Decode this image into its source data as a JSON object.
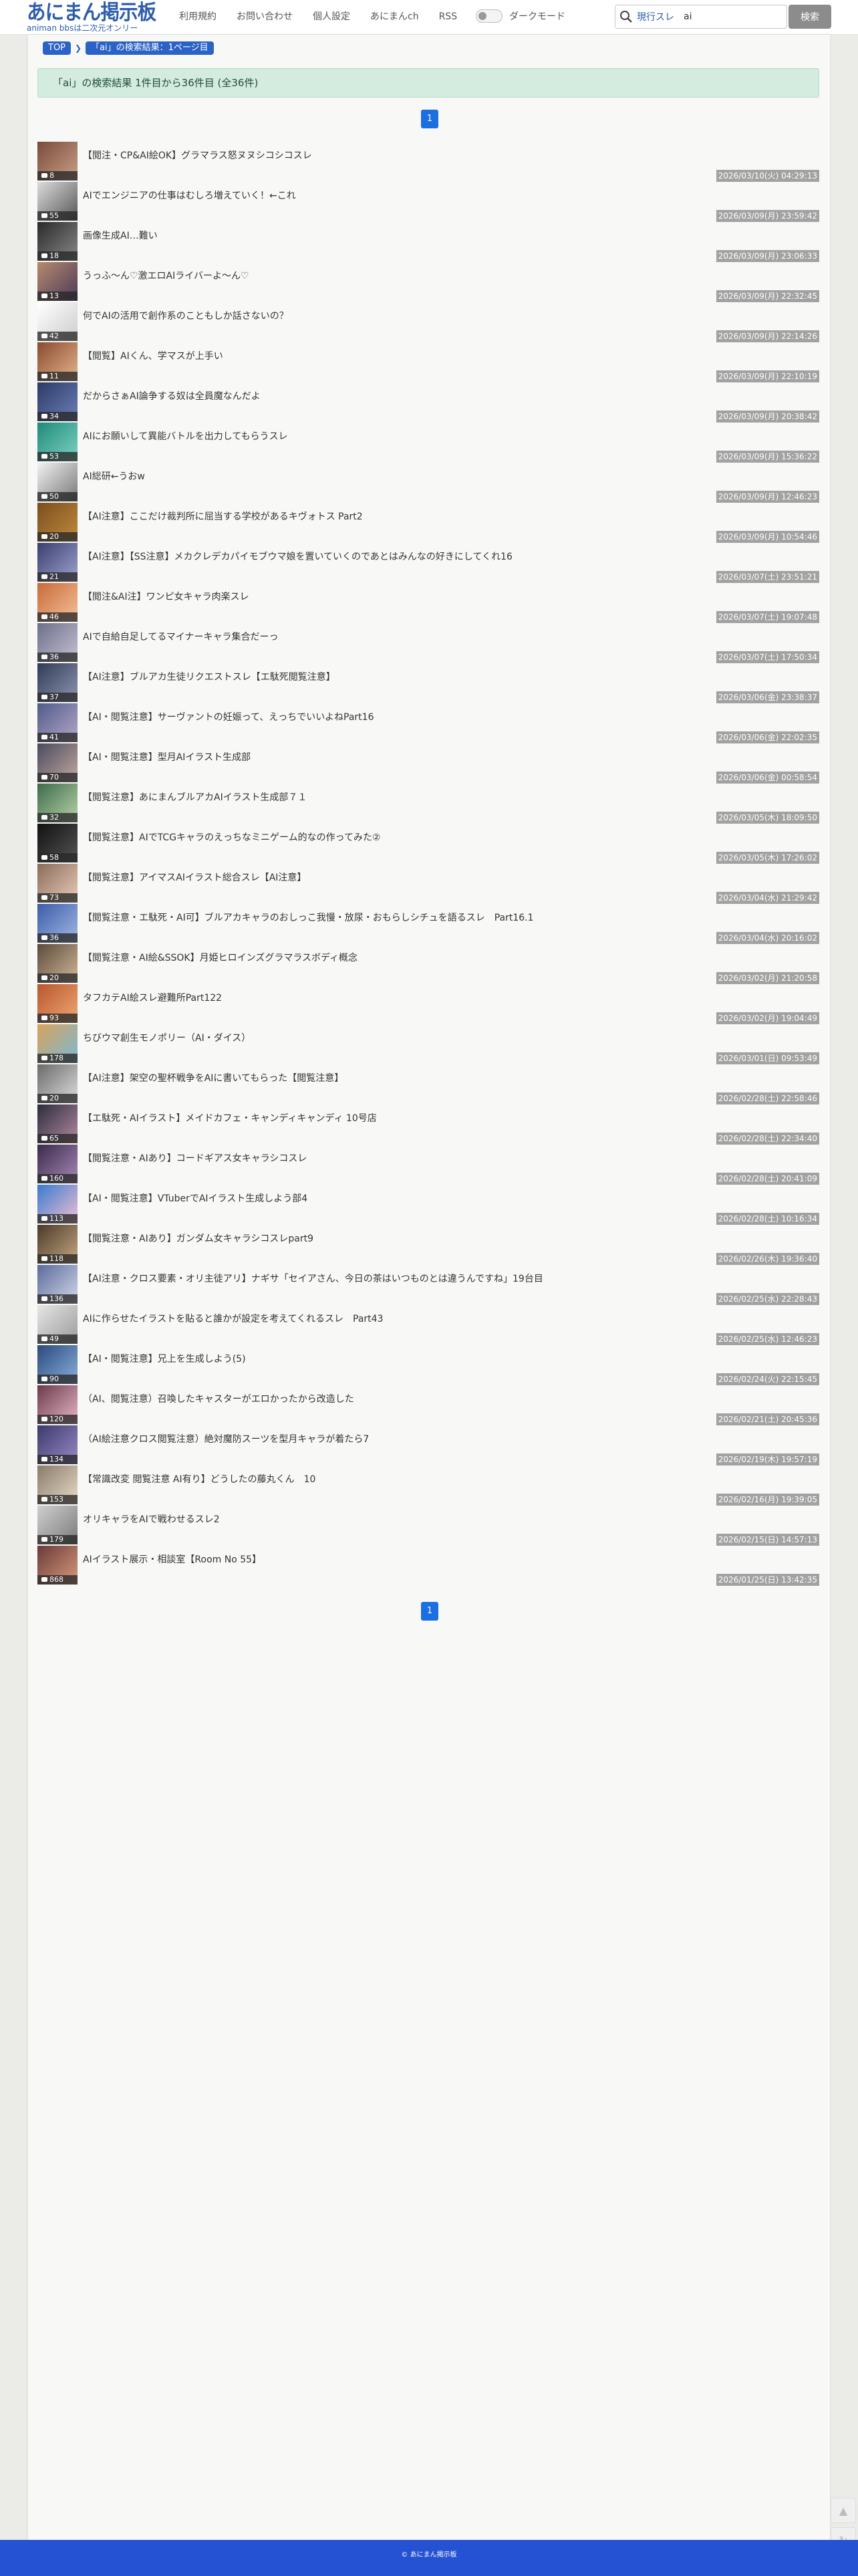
{
  "header": {
    "logo_main": "あにまん掲示板",
    "logo_sub": "animan bbsは二次元オンリー",
    "nav": [
      "利用規約",
      "お問い合わせ",
      "個人設定",
      "あにまんch",
      "RSS"
    ],
    "dark_mode_label": "ダークモード",
    "search_scope": "現行スレ",
    "search_value": "ai",
    "search_button": "検索"
  },
  "breadcrumb": [
    "TOP",
    "「ai」の検索結果：1ページ目"
  ],
  "result_banner": "「ai」の検索結果 1件目から36件目 (全36件)",
  "pagination": {
    "current": "1"
  },
  "threads": [
    {
      "title": "【閲注・CP&AI絵OK】グラマラス怒ヌヌシコシコスレ",
      "count": "8",
      "date": "2026/03/10(火) 04:29:13",
      "c1": "#7a4a3a",
      "c2": "#c9a187"
    },
    {
      "title": "AIでエンジニアの仕事はむしろ増えていく！←これ",
      "count": "55",
      "date": "2026/03/09(月) 23:59:42",
      "c1": "#dcdcdc",
      "c2": "#555555"
    },
    {
      "title": "画像生成AI…難い",
      "count": "18",
      "date": "2026/03/09(月) 23:06:33",
      "c1": "#2a2a2a",
      "c2": "#888888"
    },
    {
      "title": "うっふ〜ん♡激エロAIライバーよ〜ん♡",
      "count": "13",
      "date": "2026/03/09(月) 22:32:45",
      "c1": "#b88a6c",
      "c2": "#4a3a5a"
    },
    {
      "title": "何でAIの活用で創作系のこともしか話さないの？",
      "count": "42",
      "date": "2026/03/09(月) 22:14:26",
      "c1": "#ffffff",
      "c2": "#cccccc"
    },
    {
      "title": "【閲覧】AIくん、学マスが上手い",
      "count": "11",
      "date": "2026/03/09(月) 22:10:19",
      "c1": "#8b4a2f",
      "c2": "#e4b58d"
    },
    {
      "title": "だからさぁAI論争する奴は全員魔なんだよ",
      "count": "34",
      "date": "2026/03/09(月) 20:38:42",
      "c1": "#2c3a66",
      "c2": "#6b7fb8"
    },
    {
      "title": "AIにお願いして異能バトルを出力してもらうスレ",
      "count": "53",
      "date": "2026/03/09(月) 15:36:22",
      "c1": "#1f8a7a",
      "c2": "#7fd3c2"
    },
    {
      "title": "AI総研←うおw",
      "count": "50",
      "date": "2026/03/09(月) 12:46:23",
      "c1": "#f2f2f2",
      "c2": "#777777"
    },
    {
      "title": "【AI注意】ここだけ裁判所に屈当する学校があるキヴォトス Part2",
      "count": "20",
      "date": "2026/03/09(月) 10:54:46",
      "c1": "#7a4f1f",
      "c2": "#c08a3e"
    },
    {
      "title": "【AI注意】【SS注意】メカクレデカパイモブウマ娘を置いていくのであとはみんなの好きにしてくれ16",
      "count": "21",
      "date": "2026/03/07(土) 23:51:21",
      "c1": "#3a3f6e",
      "c2": "#9ea3cf"
    },
    {
      "title": "【閲注&AI注】ワンピ女キャラ肉楽スレ",
      "count": "46",
      "date": "2026/03/07(土) 19:07:48",
      "c1": "#c96a3a",
      "c2": "#f3c29a"
    },
    {
      "title": "AIで自給自足してるマイナーキャラ集合だーっ",
      "count": "36",
      "date": "2026/03/07(土) 17:50:34",
      "c1": "#6b6f8a",
      "c2": "#c7c2d2"
    },
    {
      "title": "【AI注意】ブルアカ生徒リクエストスレ【エ駄死閲覧注意】",
      "count": "37",
      "date": "2026/03/06(金) 23:38:37",
      "c1": "#2f3b55",
      "c2": "#8f96b3"
    },
    {
      "title": "【AI・閲覧注意】サーヴァントの妊娠って、えっちでいいよねPart16",
      "count": "41",
      "date": "2026/03/06(金) 22:02:35",
      "c1": "#4f5b8a",
      "c2": "#b7a8c9"
    },
    {
      "title": "【AI・閲覧注意】型月AIイラスト生成部",
      "count": "70",
      "date": "2026/03/06(金) 00:58:54",
      "c1": "#4a4a5e",
      "c2": "#c2a9a0"
    },
    {
      "title": "【閲覧注意】あにまんブルアカAIイラスト生成部７１",
      "count": "32",
      "date": "2026/03/05(木) 18:09:50",
      "c1": "#3d6b4a",
      "c2": "#b9d4a9"
    },
    {
      "title": "【閲覧注意】AIでTCGキャラのえっちなミニゲーム的なの作ってみた②",
      "count": "58",
      "date": "2026/03/05(木) 17:26:02",
      "c1": "#111111",
      "c2": "#555555"
    },
    {
      "title": "【閲覧注意】アイマスAIイラスト総合スレ【AI注意】",
      "count": "73",
      "date": "2026/03/04(水) 21:29:42",
      "c1": "#8a6b5a",
      "c2": "#e8cdb8"
    },
    {
      "title": "【閲覧注意・エ駄死・AI可】ブルアカキャラのおしっこ我慢・放尿・おもらしシチュを語るスレ　Part16.1",
      "count": "36",
      "date": "2026/03/04(水) 20:16:02",
      "c1": "#3b5ca8",
      "c2": "#a3b9e4"
    },
    {
      "title": "【閲覧注意・AI絵&SSOK】月姫ヒロインズグラマラスボディ概念",
      "count": "20",
      "date": "2026/03/02(月) 21:20:58",
      "c1": "#5a4a3a",
      "c2": "#d2b89a"
    },
    {
      "title": "タフカテAI絵スレ避難所Part122",
      "count": "93",
      "date": "2026/03/02(月) 19:04:49",
      "c1": "#b8562f",
      "c2": "#f0a872"
    },
    {
      "title": "ちびウマ創生モノポリー（AI・ダイス）",
      "count": "178",
      "date": "2026/03/01(日) 09:53:49",
      "c1": "#d8a35a",
      "c2": "#7ab8d8"
    },
    {
      "title": "【AI注意】架空の聖杯戦争をAIに書いてもらった【閲覧注意】",
      "count": "20",
      "date": "2026/02/28(土) 22:58:46",
      "c1": "#6a6a6a",
      "c2": "#dedede"
    },
    {
      "title": "【エ駄死・AIイラスト】メイドカフェ・キャンディキャンディ 10号店",
      "count": "65",
      "date": "2026/02/28(土) 22:34:40",
      "c1": "#2c2c3c",
      "c2": "#b48aa2"
    },
    {
      "title": "【閲覧注意・AIあり】コードギアス女キャラシコスレ",
      "count": "160",
      "date": "2026/02/28(土) 20:41:09",
      "c1": "#3a2a4a",
      "c2": "#a88ab8"
    },
    {
      "title": "【AI・閲覧注意】VTuberでAIイラスト生成しよう部4",
      "count": "113",
      "date": "2026/02/28(土) 10:16:34",
      "c1": "#3a7ad0",
      "c2": "#f1c0d0"
    },
    {
      "title": "【閲覧注意・AIあり】ガンダム女キャラシコスレpart9",
      "count": "118",
      "date": "2026/02/26(木) 19:36:40",
      "c1": "#4a3a2a",
      "c2": "#c8a882"
    },
    {
      "title": "【AI注意・クロス要素・オリ主徒アリ】ナギサ「セイアさん、今日の茶はいつものとは違うんですね」19台目",
      "count": "136",
      "date": "2026/02/25(水) 22:28:43",
      "c1": "#5a6a9a",
      "c2": "#d4d8ea"
    },
    {
      "title": "AIに作らせたイラストを貼ると誰かが設定を考えてくれるスレ　Part43",
      "count": "49",
      "date": "2026/02/25(水) 12:46:23",
      "c1": "#e6e6e6",
      "c2": "#9a9a9a"
    },
    {
      "title": "【AI・閲覧注意】兄上を生成しよう(5)",
      "count": "90",
      "date": "2026/02/24(火) 22:15:45",
      "c1": "#2a4a7a",
      "c2": "#8ab0e0"
    },
    {
      "title": "（AI、閲覧注意）召喚したキャスターがエロかったから改造した",
      "count": "120",
      "date": "2026/02/21(土) 20:45:36",
      "c1": "#6a3a4a",
      "c2": "#e8b8c8"
    },
    {
      "title": "（AI絵注意クロス閲覧注意）絶対魔防スーツを型月キャラが着たら7",
      "count": "134",
      "date": "2026/02/19(木) 19:57:19",
      "c1": "#3a3a6a",
      "c2": "#9a8ac8"
    },
    {
      "title": "【常識改変 閲覧注意 AI有り】どうしたの藤丸くん　10",
      "count": "153",
      "date": "2026/02/16(月) 19:39:05",
      "c1": "#8a7a6a",
      "c2": "#e8dcc8"
    },
    {
      "title": "オリキャラをAIで戦わせるスレ2",
      "count": "179",
      "date": "2026/02/15(日) 14:57:13",
      "c1": "#cfcfcf",
      "c2": "#7a7a7a"
    },
    {
      "title": "AIイラスト展示・相談室【Room No 55】",
      "count": "868",
      "date": "2026/01/25(日) 13:42:35",
      "c1": "#6a3a3a",
      "c2": "#d89a7a"
    }
  ],
  "footer": "© あにまん掲示板"
}
